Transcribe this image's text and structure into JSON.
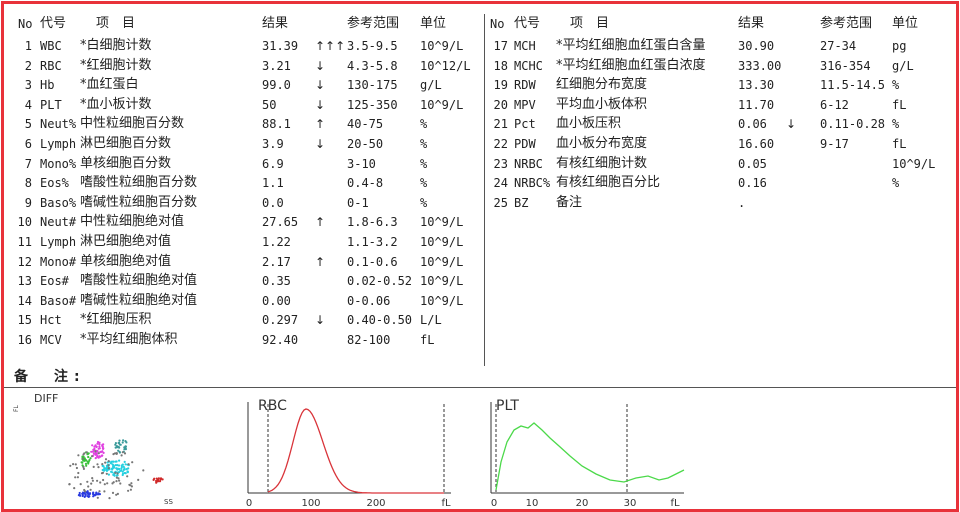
{
  "header": {
    "no": "No",
    "code": "代号",
    "item": "项　目",
    "result": "结果",
    "range": "参考范围",
    "unit": "单位"
  },
  "left_rows": [
    {
      "no": "1",
      "code": "WBC",
      "name": "*白细胞计数",
      "result": "31.39",
      "flag": "↑↑↑",
      "range": "3.5-9.5",
      "unit": "10^9/L"
    },
    {
      "no": "2",
      "code": "RBC",
      "name": "*红细胞计数",
      "result": "3.21",
      "flag": "↓",
      "range": "4.3-5.8",
      "unit": "10^12/L"
    },
    {
      "no": "3",
      "code": "Hb",
      "name": "*血红蛋白",
      "result": "99.0",
      "flag": "↓",
      "range": "130-175",
      "unit": "g/L"
    },
    {
      "no": "4",
      "code": "PLT",
      "name": "*血小板计数",
      "result": "50",
      "flag": "↓",
      "range": "125-350",
      "unit": "10^9/L"
    },
    {
      "no": "5",
      "code": "Neut%",
      "name": "中性粒细胞百分数",
      "result": "88.1",
      "flag": "↑",
      "range": "40-75",
      "unit": "%"
    },
    {
      "no": "6",
      "code": "Lymph",
      "name": "淋巴细胞百分数",
      "result": "3.9",
      "flag": "↓",
      "range": "20-50",
      "unit": "%"
    },
    {
      "no": "7",
      "code": "Mono%",
      "name": "单核细胞百分数",
      "result": "6.9",
      "flag": "",
      "range": "3-10",
      "unit": "%"
    },
    {
      "no": "8",
      "code": "Eos%",
      "name": "嗜酸性粒细胞百分数",
      "result": "1.1",
      "flag": "",
      "range": "0.4-8",
      "unit": "%"
    },
    {
      "no": "9",
      "code": "Baso%",
      "name": "嗜碱性粒细胞百分数",
      "result": "0.0",
      "flag": "",
      "range": "0-1",
      "unit": "%"
    },
    {
      "no": "10",
      "code": "Neut#",
      "name": "中性粒细胞绝对值",
      "result": "27.65",
      "flag": "↑",
      "range": "1.8-6.3",
      "unit": "10^9/L"
    },
    {
      "no": "11",
      "code": "Lymph",
      "name": "淋巴细胞绝对值",
      "result": "1.22",
      "flag": "",
      "range": "1.1-3.2",
      "unit": "10^9/L"
    },
    {
      "no": "12",
      "code": "Mono#",
      "name": "单核细胞绝对值",
      "result": "2.17",
      "flag": "↑",
      "range": "0.1-0.6",
      "unit": "10^9/L"
    },
    {
      "no": "13",
      "code": "Eos#",
      "name": "嗜酸性粒细胞绝对值",
      "result": "0.35",
      "flag": "",
      "range": "0.02-0.52",
      "unit": "10^9/L"
    },
    {
      "no": "14",
      "code": "Baso#",
      "name": "嗜碱性粒细胞绝对值",
      "result": "0.00",
      "flag": "",
      "range": "0-0.06",
      "unit": "10^9/L"
    },
    {
      "no": "15",
      "code": "Hct",
      "name": "*红细胞压积",
      "result": "0.297",
      "flag": "↓",
      "range": "0.40-0.50",
      "unit": "L/L"
    },
    {
      "no": "16",
      "code": "MCV",
      "name": "*平均红细胞体积",
      "result": "92.40",
      "flag": "",
      "range": "82-100",
      "unit": "fL"
    }
  ],
  "right_rows": [
    {
      "no": "17",
      "code": "MCH",
      "name": "*平均红细胞血红蛋白含量",
      "result": "30.90",
      "flag": "",
      "range": "27-34",
      "unit": "pg"
    },
    {
      "no": "18",
      "code": "MCHC",
      "name": "*平均红细胞血红蛋白浓度",
      "result": "333.00",
      "flag": "",
      "range": "316-354",
      "unit": "g/L"
    },
    {
      "no": "19",
      "code": "RDW",
      "name": "红细胞分布宽度",
      "result": "13.30",
      "flag": "",
      "range": "11.5-14.5",
      "unit": "%"
    },
    {
      "no": "20",
      "code": "MPV",
      "name": "平均血小板体积",
      "result": "11.70",
      "flag": "",
      "range": "6-12",
      "unit": "fL"
    },
    {
      "no": "21",
      "code": "Pct",
      "name": "血小板压积",
      "result": "0.06",
      "flag": "↓",
      "range": "0.11-0.28",
      "unit": "%"
    },
    {
      "no": "22",
      "code": "PDW",
      "name": "血小板分布宽度",
      "result": "16.60",
      "flag": "",
      "range": "9-17",
      "unit": "fL"
    },
    {
      "no": "23",
      "code": "NRBC",
      "name": "有核红细胞计数",
      "result": "0.05",
      "flag": "",
      "range": "",
      "unit": "10^9/L"
    },
    {
      "no": "24",
      "code": "NRBC%",
      "name": "有核红细胞百分比",
      "result": "0.16",
      "flag": "",
      "range": "",
      "unit": "%"
    },
    {
      "no": "25",
      "code": "BZ",
      "name": "备注",
      "result": ".",
      "flag": "",
      "range": "",
      "unit": ""
    }
  ],
  "remarks_label": "备　注:",
  "graphs": {
    "diff": {
      "title": "DIFF",
      "y_label": "FL",
      "x_label": "SS"
    },
    "rbc": {
      "title": "RBC",
      "ticks": [
        "0",
        "100",
        "200",
        "fL"
      ],
      "color": "#d9343a"
    },
    "plt": {
      "title": "PLT",
      "ticks": [
        "0",
        "10",
        "20",
        "30",
        "fL"
      ],
      "color": "#4cd94a"
    }
  },
  "colors": {
    "border": "#e8323a",
    "line": "#555555"
  }
}
